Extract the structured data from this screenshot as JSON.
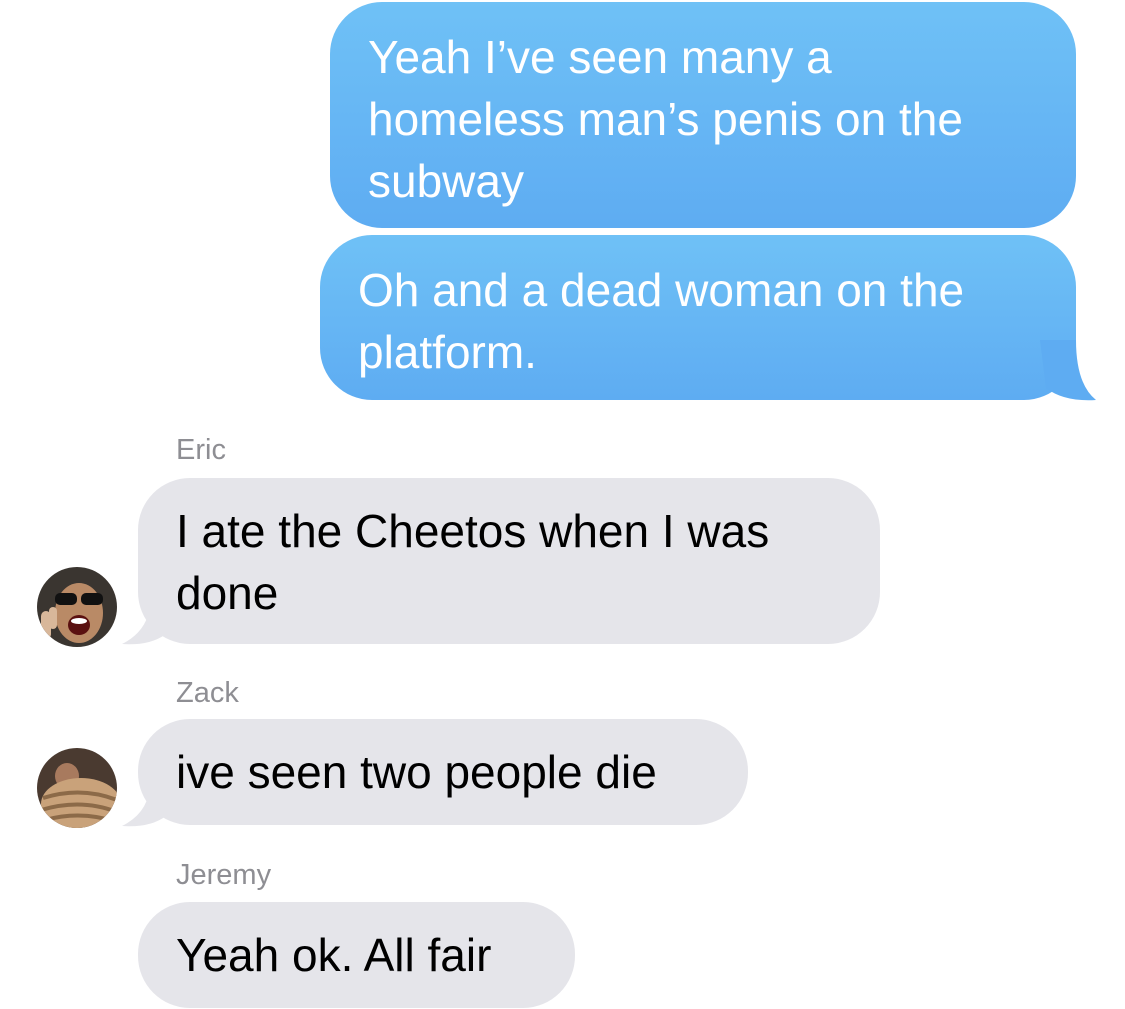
{
  "messages": {
    "outgoing_1": "Yeah I’ve seen many a homeless man’s penis on the subway",
    "outgoing_2": "Oh and a dead woman on the platform.",
    "eric": {
      "sender": "Eric",
      "text": "I ate the Cheetos when I was done"
    },
    "zack": {
      "sender": "Zack",
      "text": "ive seen two people die"
    },
    "jeremy": {
      "sender": "Jeremy",
      "text": "Yeah ok. All fair"
    }
  },
  "colors": {
    "outgoing_bubble": "#6cb8f5",
    "incoming_bubble": "#e5e5ea",
    "sender_label": "#8e8e93"
  }
}
